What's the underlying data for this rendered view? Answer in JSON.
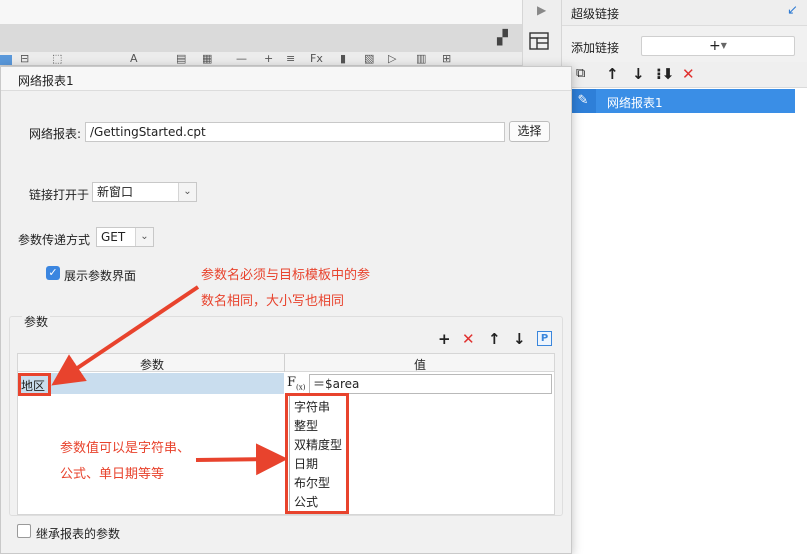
{
  "background": {
    "toolbar_glyphs": [
      "⊟",
      "⬚",
      "A",
      "▤",
      "▦",
      "—",
      "+",
      "≡",
      "Fx",
      "▮",
      "▧",
      "▷",
      "▥",
      "⊞"
    ]
  },
  "right_panel": {
    "title": "超级链接",
    "add_label": "添加链接",
    "add_button": "+",
    "link_item": "网络报表1"
  },
  "dialog": {
    "title": "网络报表1",
    "report_label": "网络报表:",
    "report_path": "/GettingStarted.cpt",
    "choose_button": "选择",
    "open_in_label": "链接打开于",
    "open_in_value": "新窗口",
    "method_label": "参数传递方式",
    "method_value": "GET",
    "show_params_label": "展示参数界面",
    "show_params_checked": true,
    "params_group_label": "参数",
    "table": {
      "col_param": "参数",
      "col_value": "值",
      "row_name": "地区",
      "row_value": "＝$area",
      "fx_label": "F(x)"
    },
    "value_types": [
      "字符串",
      "整型",
      "双精度型",
      "日期",
      "布尔型",
      "公式"
    ],
    "inherit_label": "继承报表的参数",
    "inherit_checked": false
  },
  "annotations": {
    "note1_line1": "参数名必须与目标模板中的参",
    "note1_line2": "数名相同，大小写也相同",
    "note2_line1": "参数值可以是字符串、",
    "note2_line2": "公式、单日期等等",
    "color": "#e8432d"
  }
}
